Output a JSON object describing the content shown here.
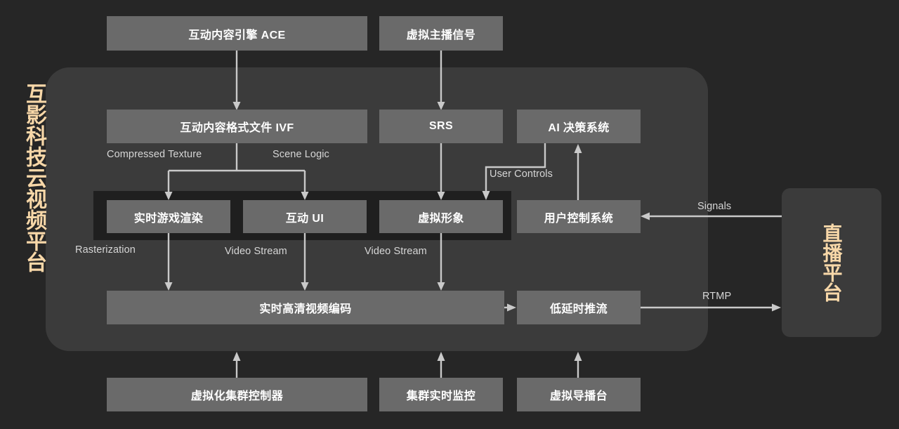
{
  "diagram": {
    "brand_title": "互影科技云视频平台",
    "external": {
      "live_platform": "直播平台"
    },
    "top_nodes": [
      {
        "id": "ace",
        "label": "互动内容引擎 ACE"
      },
      {
        "id": "anchor_signal",
        "label": "虚拟主播信号"
      }
    ],
    "layer_two": [
      {
        "id": "ivf",
        "label": "互动内容格式文件 IVF"
      },
      {
        "id": "srs",
        "label": "SRS"
      },
      {
        "id": "ai",
        "label": "AI 决策系统"
      }
    ],
    "render_group": [
      {
        "id": "game_render",
        "label": "实时游戏渲染"
      },
      {
        "id": "interactive_ui",
        "label": "互动 UI"
      },
      {
        "id": "virtual_avatar",
        "label": "虚拟形象"
      }
    ],
    "control_node": {
      "id": "user_control",
      "label": "用户控制系统"
    },
    "encode_row": [
      {
        "id": "encoder",
        "label": "实时高清视频编码"
      },
      {
        "id": "low_latency_push",
        "label": "低延时推流"
      }
    ],
    "bottom_nodes": [
      {
        "id": "cluster_controller",
        "label": "虚拟化集群控制器"
      },
      {
        "id": "cluster_monitor",
        "label": "集群实时监控"
      },
      {
        "id": "virtual_director",
        "label": "虚拟导播台"
      }
    ],
    "edge_labels": [
      {
        "id": "compressed_texture",
        "text": "Compressed Texture"
      },
      {
        "id": "scene_logic",
        "text": "Scene Logic"
      },
      {
        "id": "user_controls",
        "text": "User Controls"
      },
      {
        "id": "rasterization",
        "text": "Rasterization"
      },
      {
        "id": "video_stream_ui",
        "text": "Video Stream"
      },
      {
        "id": "video_stream_avatar",
        "text": "Video Stream"
      },
      {
        "id": "signals",
        "text": "Signals"
      },
      {
        "id": "rtmp",
        "text": "RTMP"
      }
    ],
    "colors": {
      "page_background": "#262626",
      "container_background": "#3b3b3b",
      "node_fill": "#6a6a6a",
      "group_fill": "#1f1f1f",
      "node_text": "#ffffff",
      "brand_text": "#f7d7a8",
      "edge_stroke": "#c9c9c9",
      "edge_label_text": "#d6d6d6"
    }
  }
}
